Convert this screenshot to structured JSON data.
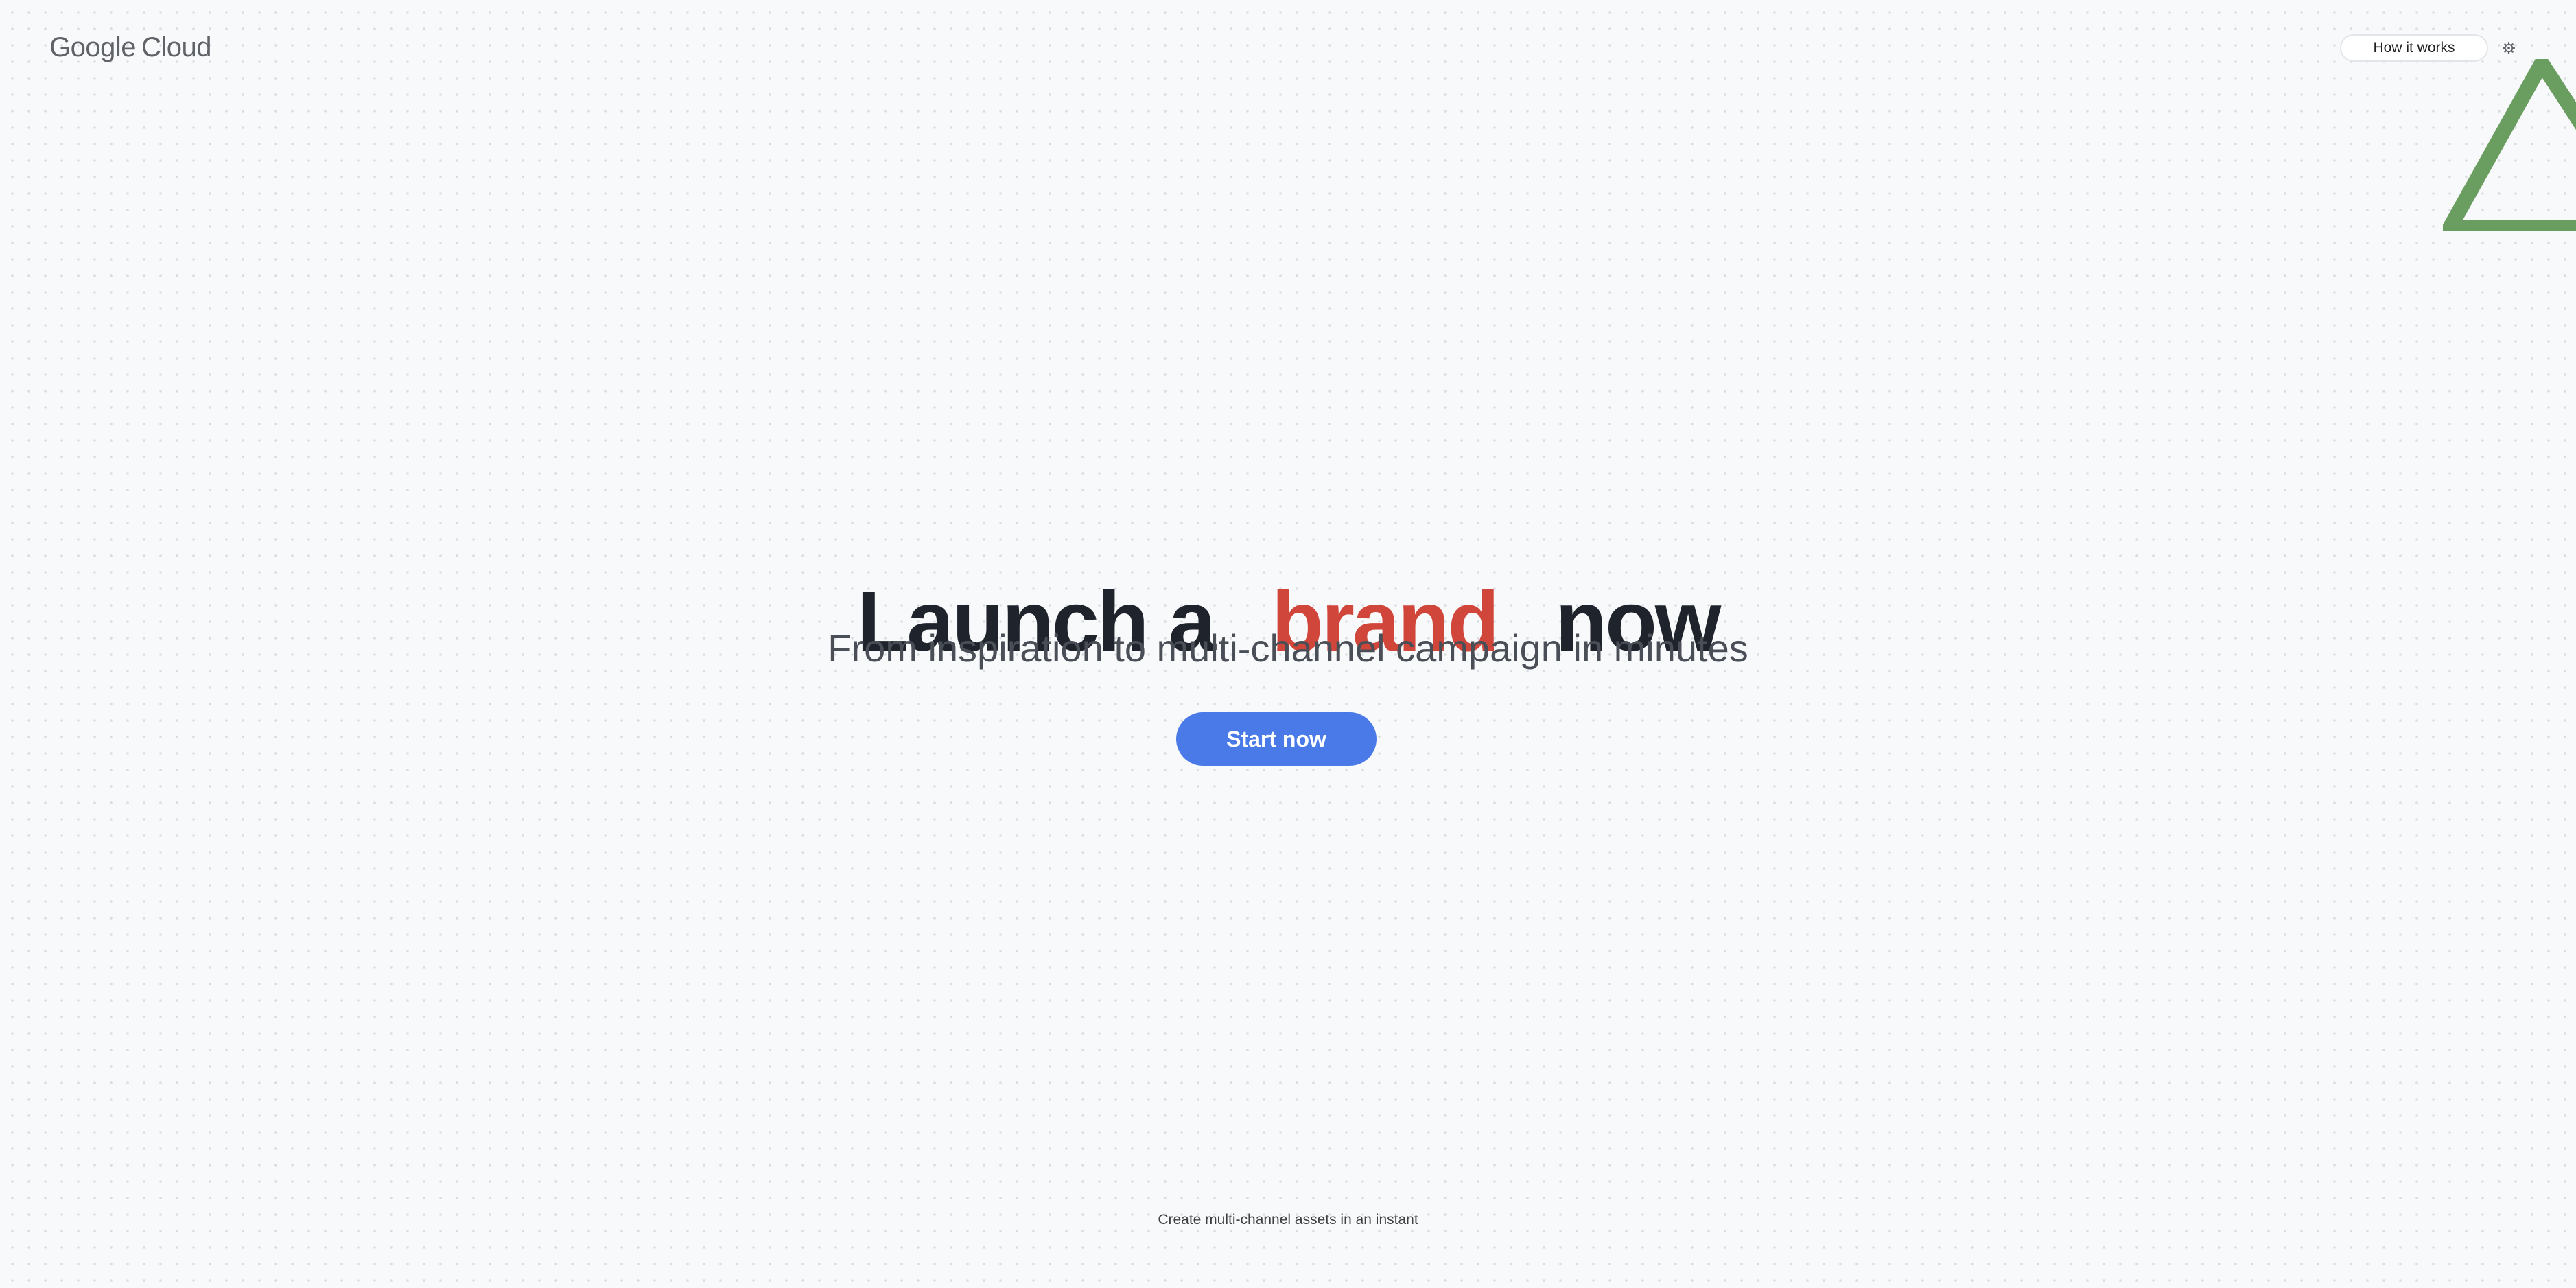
{
  "header": {
    "logo": {
      "brand": "Google",
      "product": "Cloud"
    },
    "how_it_works_label": "How it works",
    "settings_icon": "gear-icon"
  },
  "hero": {
    "headline_prefix": "Launch a",
    "headline_accent": "brand",
    "headline_suffix": "now",
    "subtitle": "From inspiration to multi-channel campaign in minutes",
    "cta_label": "Start now"
  },
  "footer": {
    "tagline": "Create multi-channel assets in an instant"
  },
  "colors": {
    "background": "#f8f9fa",
    "headline": "#1f232b",
    "accent": "#d0463a",
    "cta": "#4a79e8",
    "decoration": "#6a9e60"
  }
}
